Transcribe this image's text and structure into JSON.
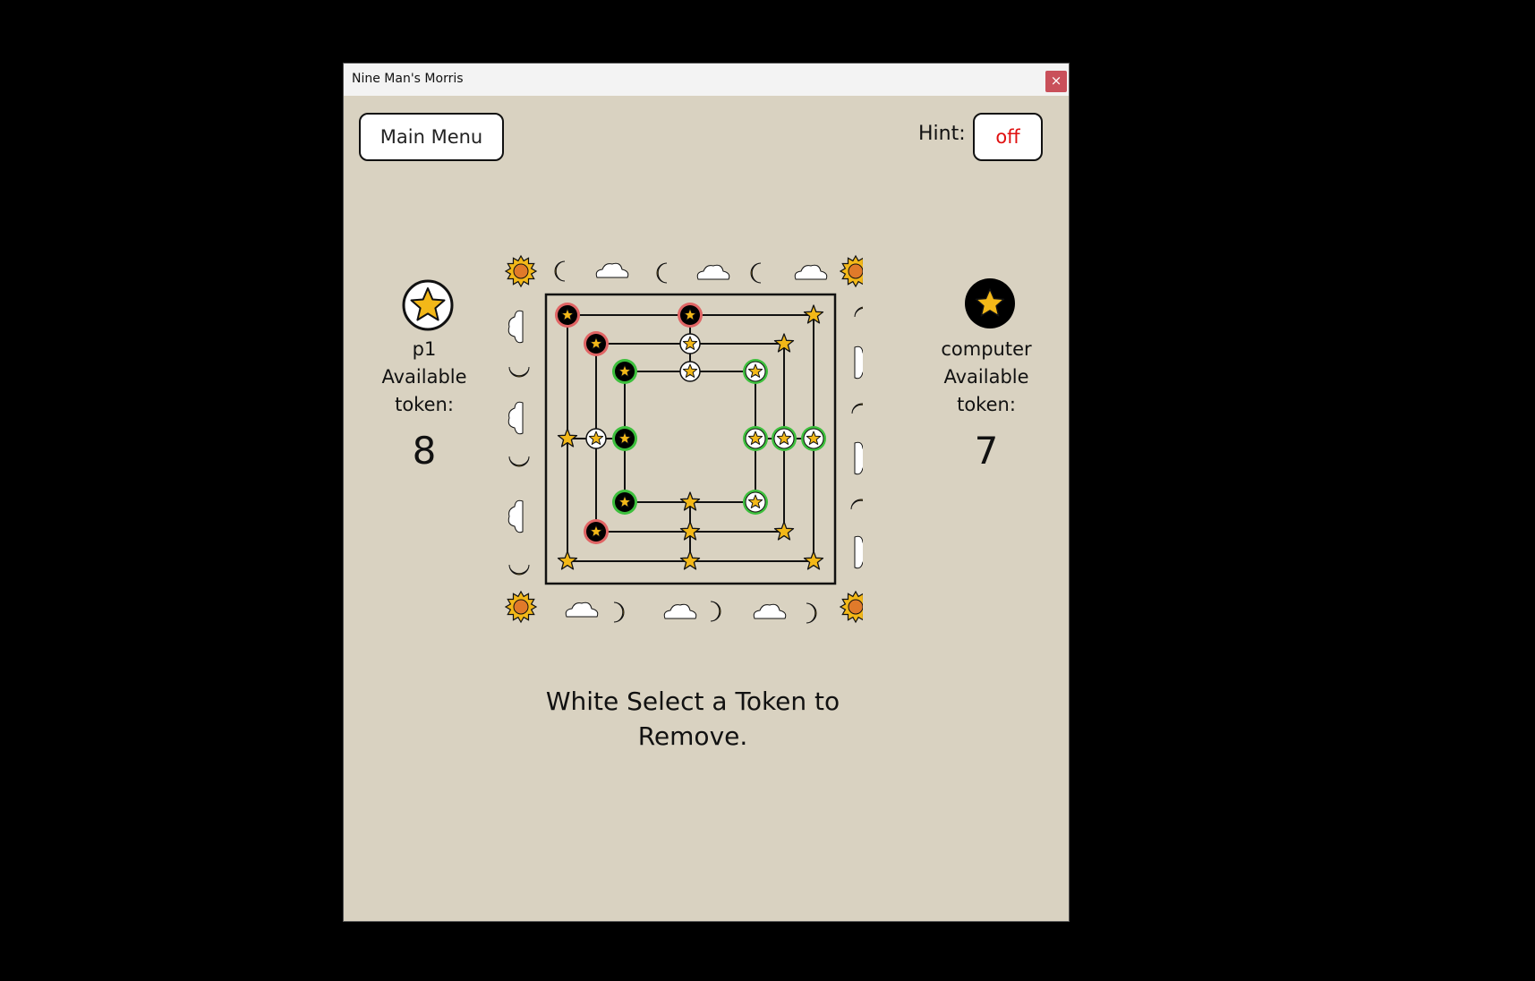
{
  "window": {
    "title": "Nine Man's Morris",
    "close_label": "×"
  },
  "toolbar": {
    "menu_label": "Main Menu",
    "hint_label": "Hint:",
    "hint_value": "off"
  },
  "players": {
    "p1": {
      "name": "p1",
      "available_label": "Available",
      "token_label": "token:",
      "count": "8",
      "color": "white"
    },
    "computer": {
      "name": "computer",
      "available_label": "Available",
      "token_label": "token:",
      "count": "7",
      "color": "black"
    }
  },
  "status": {
    "line1": "White Select a Token to",
    "line2": "Remove."
  },
  "board": {
    "pieces": [
      {
        "pos": "a7",
        "color": "black",
        "ring": "red"
      },
      {
        "pos": "d7",
        "color": "black",
        "ring": "red"
      },
      {
        "pos": "g7",
        "color": "empty"
      },
      {
        "pos": "b6",
        "color": "black",
        "ring": "red"
      },
      {
        "pos": "d6",
        "color": "white",
        "ring": "none"
      },
      {
        "pos": "f6",
        "color": "empty"
      },
      {
        "pos": "c5",
        "color": "black",
        "ring": "green"
      },
      {
        "pos": "d5",
        "color": "white",
        "ring": "none"
      },
      {
        "pos": "e5",
        "color": "white",
        "ring": "green"
      },
      {
        "pos": "a4",
        "color": "empty"
      },
      {
        "pos": "b4",
        "color": "white",
        "ring": "none"
      },
      {
        "pos": "c4",
        "color": "black",
        "ring": "green"
      },
      {
        "pos": "e4",
        "color": "white",
        "ring": "green"
      },
      {
        "pos": "f4",
        "color": "white",
        "ring": "green"
      },
      {
        "pos": "g4",
        "color": "white",
        "ring": "green"
      },
      {
        "pos": "c3",
        "color": "black",
        "ring": "green"
      },
      {
        "pos": "d3",
        "color": "empty"
      },
      {
        "pos": "e3",
        "color": "white",
        "ring": "green"
      },
      {
        "pos": "b2",
        "color": "black",
        "ring": "red"
      },
      {
        "pos": "d2",
        "color": "empty"
      },
      {
        "pos": "f2",
        "color": "empty"
      },
      {
        "pos": "a1",
        "color": "empty"
      },
      {
        "pos": "d1",
        "color": "empty"
      },
      {
        "pos": "g1",
        "color": "empty"
      }
    ],
    "colors": {
      "background": "#d9d2c1",
      "star": "#f3b818",
      "red_ring": "#e06464",
      "green_ring": "#3cbf3c",
      "sun": "#f3b818",
      "sun_core": "#e07a2a"
    }
  }
}
